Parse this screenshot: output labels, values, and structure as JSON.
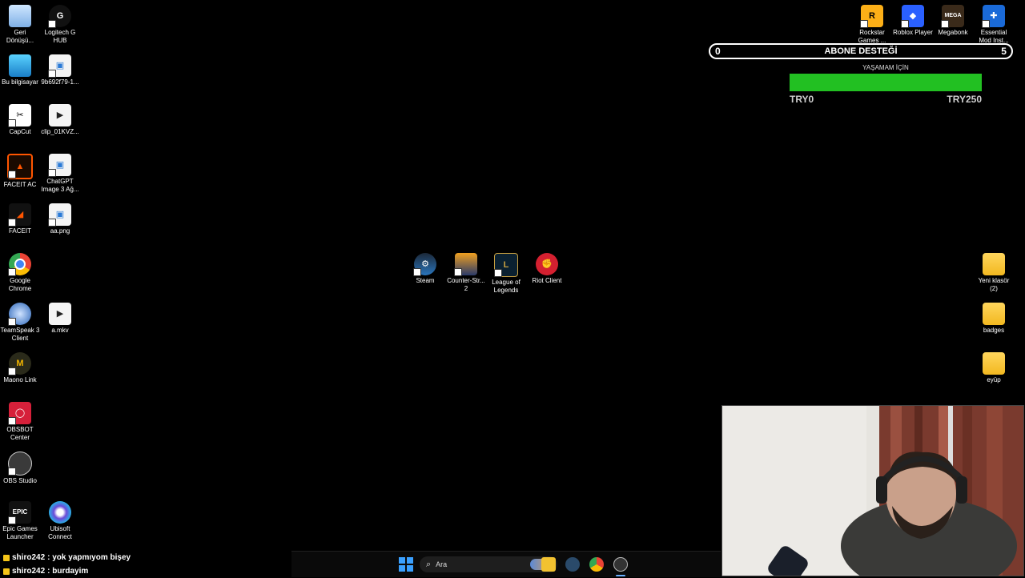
{
  "desktop_icons_left": [
    {
      "label": "Geri Dönüşü...",
      "icon": "recycle-bin-icon"
    },
    {
      "label": "Logitech G HUB",
      "icon": "logitech-ghub-icon"
    },
    {
      "label": "Bu bilgisayar",
      "icon": "this-pc-icon"
    },
    {
      "label": "9b692f79-1...",
      "icon": "image-file-icon"
    },
    {
      "label": "CapCut",
      "icon": "capcut-icon"
    },
    {
      "label": "clip_01KVZ...",
      "icon": "video-file-icon"
    },
    {
      "label": "FACEIT AC",
      "icon": "faceit-ac-icon"
    },
    {
      "label": "ChatGPT Image 3 Ağ...",
      "icon": "image-file-icon"
    },
    {
      "label": "FACEIT",
      "icon": "faceit-icon"
    },
    {
      "label": "aa.png",
      "icon": "image-file-icon"
    },
    {
      "label": "Google Chrome",
      "icon": "chrome-icon"
    },
    {
      "label": "TeamSpeak 3 Client",
      "icon": "teamspeak-icon"
    },
    {
      "label": "a.mkv",
      "icon": "video-file-icon"
    },
    {
      "label": "Maono Link",
      "icon": "maono-link-icon"
    },
    {
      "label": "OBSBOT Center",
      "icon": "obsbot-icon"
    },
    {
      "label": "OBS Studio",
      "icon": "obs-icon"
    },
    {
      "label": "Epic Games Launcher",
      "icon": "epic-games-icon"
    },
    {
      "label": "Ubisoft Connect",
      "icon": "ubisoft-icon"
    }
  ],
  "desktop_icons_center": [
    {
      "label": "Steam",
      "icon": "steam-icon"
    },
    {
      "label": "Counter-Str... 2",
      "icon": "counter-strike-icon"
    },
    {
      "label": "League of Legends",
      "icon": "league-of-legends-icon"
    },
    {
      "label": "Riot Client",
      "icon": "riot-client-icon"
    }
  ],
  "desktop_icons_top_right": [
    {
      "label": "Rockstar Games ...",
      "icon": "rockstar-icon"
    },
    {
      "label": "Roblox Player",
      "icon": "roblox-icon"
    },
    {
      "label": "Megabonk",
      "icon": "megabonk-icon"
    },
    {
      "label": "Essential Mod Inst...",
      "icon": "essential-mod-icon"
    }
  ],
  "desktop_icons_right": [
    {
      "label": "Yeni klasör (2)",
      "icon": "folder-icon"
    },
    {
      "label": "badges",
      "icon": "folder-icon"
    },
    {
      "label": "eyüp",
      "icon": "folder-icon"
    }
  ],
  "overlay": {
    "sub_title": "ABONE DESTEĞİ",
    "sub_current": "0",
    "sub_goal": "5",
    "goal_title": "YAŞAMAM İÇİN",
    "goal_min": "TRY0",
    "goal_max": "TRY250",
    "goal_progress": 0
  },
  "chat": [
    {
      "user": "shiro242",
      "message": ": yok yapmıyom bişey"
    },
    {
      "user": "shiro242",
      "message": ": burdayim"
    }
  ],
  "taskbar": {
    "search_placeholder": "Ara",
    "icons": [
      "windows-start-icon",
      "search-icon",
      "widgets-icon",
      "file-explorer-icon",
      "steam-taskbar-icon",
      "chrome-taskbar-icon",
      "obs-taskbar-icon"
    ]
  },
  "colors": {
    "goal_bar": "#22c022",
    "background": "#000000",
    "folder": "#f2b820"
  }
}
